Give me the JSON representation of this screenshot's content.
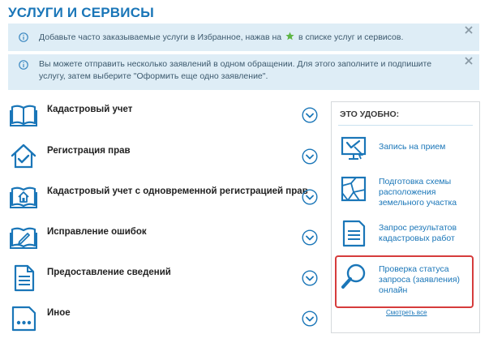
{
  "page": {
    "title": "УСЛУГИ И СЕРВИСЫ"
  },
  "alerts": [
    {
      "text_before": "Добавьте часто заказываемые услуги в Избранное, нажав на",
      "text_after": "в списке услуг и сервисов."
    },
    {
      "text": "Вы можете отправить несколько заявлений в одном обращении. Для этого заполните и подпишите услугу, затем выберите \"Оформить еще одно заявление\"."
    }
  ],
  "services": [
    {
      "label": "Кадастровый учет",
      "icon": "open-book-icon"
    },
    {
      "label": "Регистрация прав",
      "icon": "house-check-icon"
    },
    {
      "label": "Кадастровый учет с одновременной регистрацией прав",
      "icon": "book-house-icon"
    },
    {
      "label": "Исправление ошибок",
      "icon": "book-pencil-icon"
    },
    {
      "label": "Предоставление сведений",
      "icon": "document-icon"
    },
    {
      "label": "Иное",
      "icon": "more-dots-icon"
    }
  ],
  "side": {
    "title": "ЭТО УДОБНО:",
    "items": [
      {
        "label": "Запись на прием",
        "icon": "monitor-cursor-icon"
      },
      {
        "label": "Подготовка схемы расположения земельного участка",
        "icon": "land-plot-icon"
      },
      {
        "label": "Запрос результатов кадастровых работ",
        "icon": "report-icon"
      },
      {
        "label": "Проверка статуса запроса (заявления) онлайн",
        "icon": "magnifier-icon"
      }
    ],
    "see_all": "Смотреть все"
  },
  "colors": {
    "accent": "#1a76b8",
    "alert_bg": "#deedf6",
    "highlight": "#d63c3c"
  }
}
